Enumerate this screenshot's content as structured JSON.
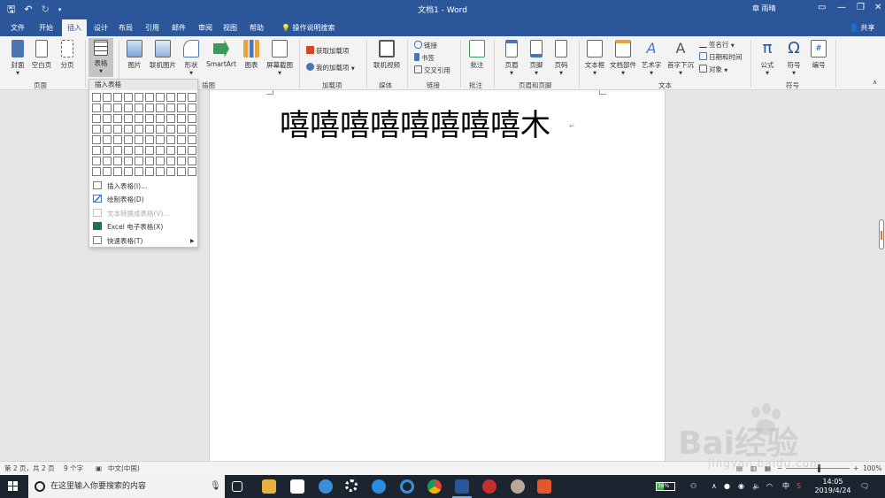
{
  "window": {
    "title": "文档1 - Word",
    "user": "章 雨晴",
    "share": "共享"
  },
  "tabs": [
    "文件",
    "开始",
    "插入",
    "设计",
    "布局",
    "引用",
    "邮件",
    "审阅",
    "视图",
    "帮助"
  ],
  "active_tab": "插入",
  "tell_me": "操作说明搜索",
  "ribbon": {
    "pages_group": {
      "label": "页面",
      "cover": "封面",
      "blank_page": "空白页",
      "page_break": "分页"
    },
    "tables_group": {
      "table": "表格"
    },
    "illustrations_group": {
      "label": "插图",
      "pictures": "图片",
      "online_pictures": "联机图片",
      "shapes": "形状",
      "smartart": "SmartArt",
      "chart": "图表",
      "screenshot": "屏幕截图"
    },
    "addins_group": {
      "label": "加载项",
      "get_addins": "获取加载项",
      "my_addins": "我的加载项"
    },
    "media_group": {
      "label": "媒体",
      "online_video": "联机视频"
    },
    "links_group": {
      "label": "链接",
      "link": "链接",
      "bookmark": "书签",
      "cross_ref": "交叉引用"
    },
    "comments_group": {
      "label": "批注",
      "comment": "批注"
    },
    "header_footer_group": {
      "label": "页眉和页脚",
      "header": "页眉",
      "footer": "页脚",
      "page_number": "页码"
    },
    "text_group": {
      "label": "文本",
      "text_box": "文本框",
      "quick_parts": "文档部件",
      "wordart": "艺术字",
      "drop_cap": "首字下沉",
      "signature_line": "签名行",
      "date_time": "日期和时间",
      "object": "对象"
    },
    "symbols_group": {
      "label": "符号",
      "equation": "公式",
      "symbol": "符号",
      "numbering": "编号"
    }
  },
  "table_dropdown": {
    "header": "插入表格",
    "grid_cols": 10,
    "grid_rows": 8,
    "items": [
      {
        "label": "插入表格(I)...",
        "disabled": false,
        "color": "#6d7f99"
      },
      {
        "label": "绘制表格(D)",
        "disabled": false,
        "color": "#4a76b8"
      },
      {
        "label": "文本转换成表格(V)...",
        "disabled": true,
        "color": "#c5c5c5"
      },
      {
        "label": "Excel 电子表格(X)",
        "disabled": false,
        "color": "#217346"
      },
      {
        "label": "快速表格(T)",
        "disabled": false,
        "color": "#6d7f99"
      }
    ]
  },
  "document": {
    "text": "嘻嘻嘻嘻嘻嘻嘻嘻木",
    "paragraph_mark": "↵"
  },
  "statusbar": {
    "page": "第 2 页，共 2 页",
    "words": "9 个字",
    "language": "中文(中国)",
    "zoom": "100%"
  },
  "taskbar": {
    "search_placeholder": "在这里输入你要搜索的内容",
    "battery": "38%",
    "battery_level": 0.38,
    "ime": "中",
    "time": "14:05",
    "date": "2019/4/24"
  },
  "watermark": {
    "brand": "Bai经验",
    "url": "jingyan.baidu.com"
  },
  "colors": {
    "titlebar": "#2b579a",
    "ribbon": "#f3f3f3",
    "taskbar": "#1c2430"
  }
}
